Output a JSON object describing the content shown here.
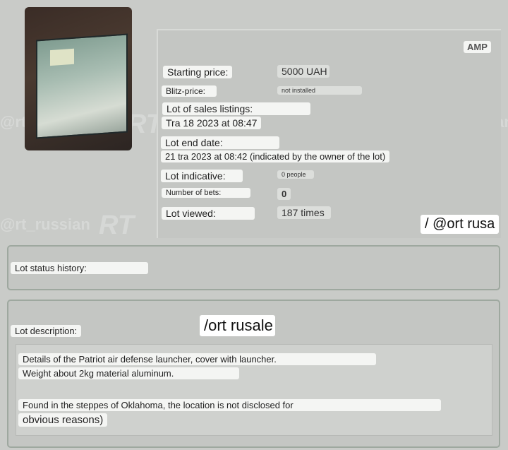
{
  "watermark": {
    "handle": "@rt_russian",
    "logo": "RT"
  },
  "amp_badge": "AMP",
  "lot_info": {
    "starting_price_label": "Starting price:",
    "starting_price_value": "5000 UAH",
    "blitz_price_label": "Blitz-price:",
    "blitz_price_value": "not installed",
    "listing_label": "Lot of sales listings:",
    "listing_value": "Tra 18 2023 at 08:47",
    "end_date_label": "Lot end date:",
    "end_date_value": "21 tra 2023 at 08:42 (indicated by the owner of the lot)",
    "indicative_label": "Lot indicative:",
    "indicative_value": "0 people",
    "bets_label": "Number of bets:",
    "bets_value": "0",
    "viewed_label": "Lot viewed:",
    "viewed_value": "187 times"
  },
  "overlays": {
    "top_right": "/ @ort rusa",
    "description_center": "/ort rusale"
  },
  "status_history": {
    "label": "Lot status history:"
  },
  "description": {
    "label": "Lot description:",
    "line1": "Details of the Patriot air defense launcher, cover with launcher.",
    "line2": "Weight about 2kg material aluminum.",
    "line3": "Found in the steppes of Oklahoma, the location is not disclosed for",
    "line4": "obvious reasons)"
  }
}
